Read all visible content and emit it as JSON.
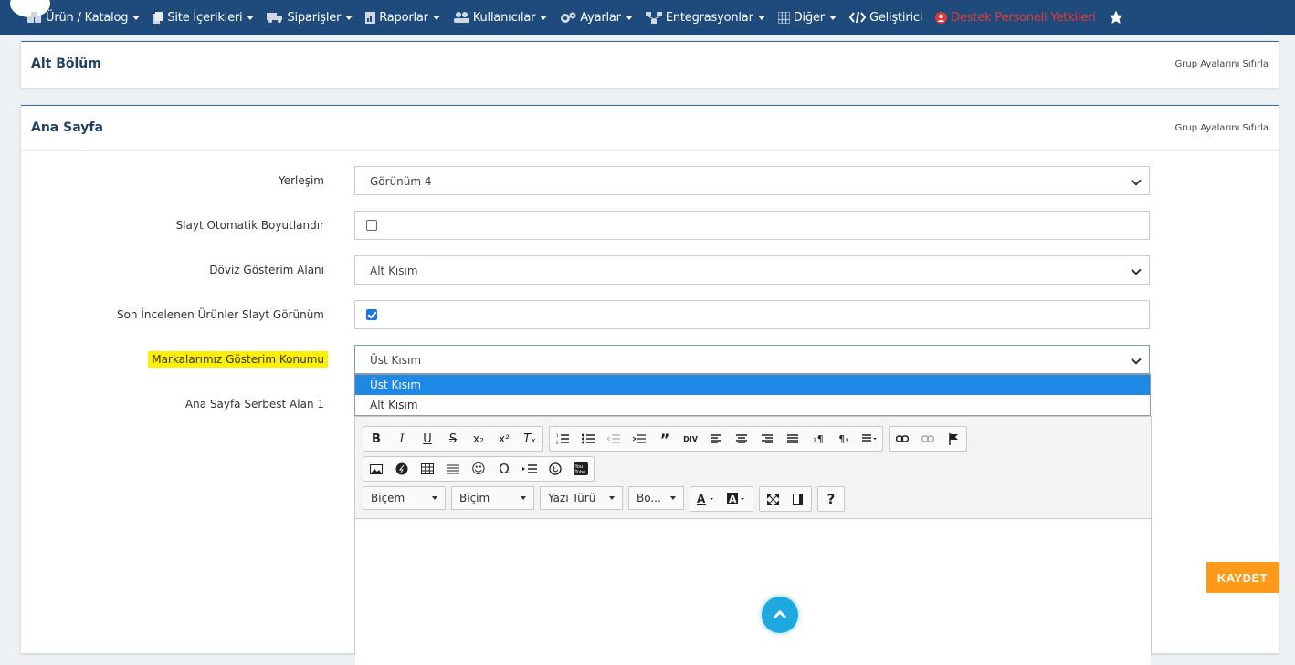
{
  "nav": {
    "items": [
      {
        "label": "Ürün / Katalog",
        "icon": "boxes-icon",
        "caret": true
      },
      {
        "label": "Site İçerikleri",
        "icon": "copy-icon",
        "caret": true
      },
      {
        "label": "Siparişler",
        "icon": "truck-icon",
        "caret": true
      },
      {
        "label": "Raporlar",
        "icon": "report-icon",
        "caret": true
      },
      {
        "label": "Kullanıcılar",
        "icon": "users-icon",
        "caret": true
      },
      {
        "label": "Ayarlar",
        "icon": "gears-icon",
        "caret": true
      },
      {
        "label": "Entegrasyonlar",
        "icon": "sitemap-icon",
        "caret": true
      },
      {
        "label": "Diğer",
        "icon": "grid-icon",
        "caret": true
      },
      {
        "label": "Geliştirici",
        "icon": "code-icon",
        "caret": false
      },
      {
        "label": "Destek Personeli Yetkileri",
        "icon": "user-circle-icon",
        "caret": false
      }
    ]
  },
  "panels": {
    "alt": {
      "title": "Alt Bölüm",
      "reset": "Grup Ayalarını Sıfırla"
    },
    "ana": {
      "title": "Ana Sayfa",
      "reset": "Grup Ayalarını Sıfırla"
    }
  },
  "form": {
    "yerlesim": {
      "label": "Yerleşim",
      "value": "Görünüm 4"
    },
    "slayt": {
      "label": "Slayt Otomatik Boyutlandır",
      "checked": false
    },
    "doviz": {
      "label": "Döviz Gösterim Alanı",
      "value": "Alt Kısım"
    },
    "son": {
      "label": "Son İncelenen Ürünler Slayt Görünüm",
      "checked": true
    },
    "markalar": {
      "label": "Markalarımız Gösterim Konumu",
      "value": "Üst Kısım",
      "options": [
        "Üst Kısım",
        "Alt Kısım"
      ]
    },
    "serbest": {
      "label": "Ana Sayfa Serbest Alan 1"
    }
  },
  "editor": {
    "combos": [
      "Biçem",
      "Biçim",
      "Yazı Türü",
      "Bo..."
    ]
  },
  "actions": {
    "save": "KAYDET"
  },
  "colors": {
    "navbar": "#1f4b7c",
    "accent": "#ff9a1a",
    "support": "#e53935",
    "highlight": "#ffef00"
  }
}
